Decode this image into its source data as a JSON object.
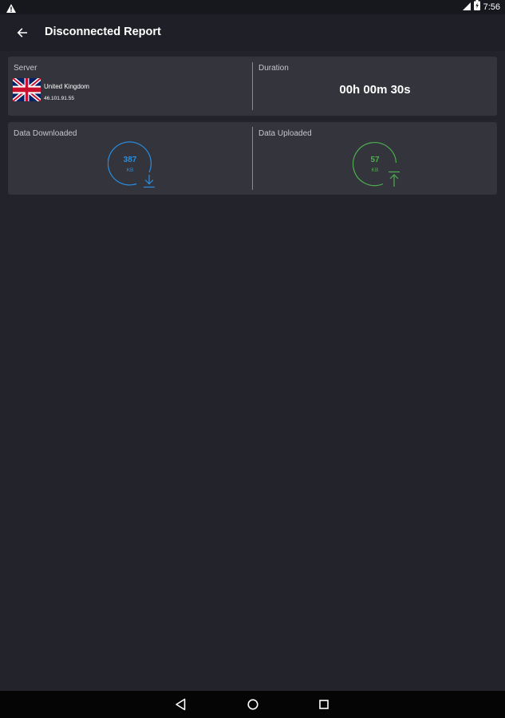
{
  "status_bar": {
    "time": "7:56",
    "icons": [
      "warning-icon",
      "signal-icon",
      "battery-icon"
    ]
  },
  "app_bar": {
    "title": "Disconnected Report",
    "back_icon": "arrow-left-icon"
  },
  "server": {
    "label": "Server",
    "country": "United Kingdom",
    "ip": "46.101.91.55",
    "flag_icon": "uk-flag-icon"
  },
  "duration": {
    "label": "Duration",
    "value": "00h 00m 30s"
  },
  "downloaded": {
    "label": "Data Downloaded",
    "value": "387",
    "unit": "KB",
    "color": "#2b8ee0",
    "icon": "download-arrow-icon"
  },
  "uploaded": {
    "label": "Data Uploaded",
    "value": "57",
    "unit": "KB",
    "color": "#4fae4f",
    "icon": "upload-arrow-icon"
  },
  "nav_bar": {
    "icons": [
      "back-triangle-icon",
      "home-circle-icon",
      "recents-square-icon"
    ]
  }
}
